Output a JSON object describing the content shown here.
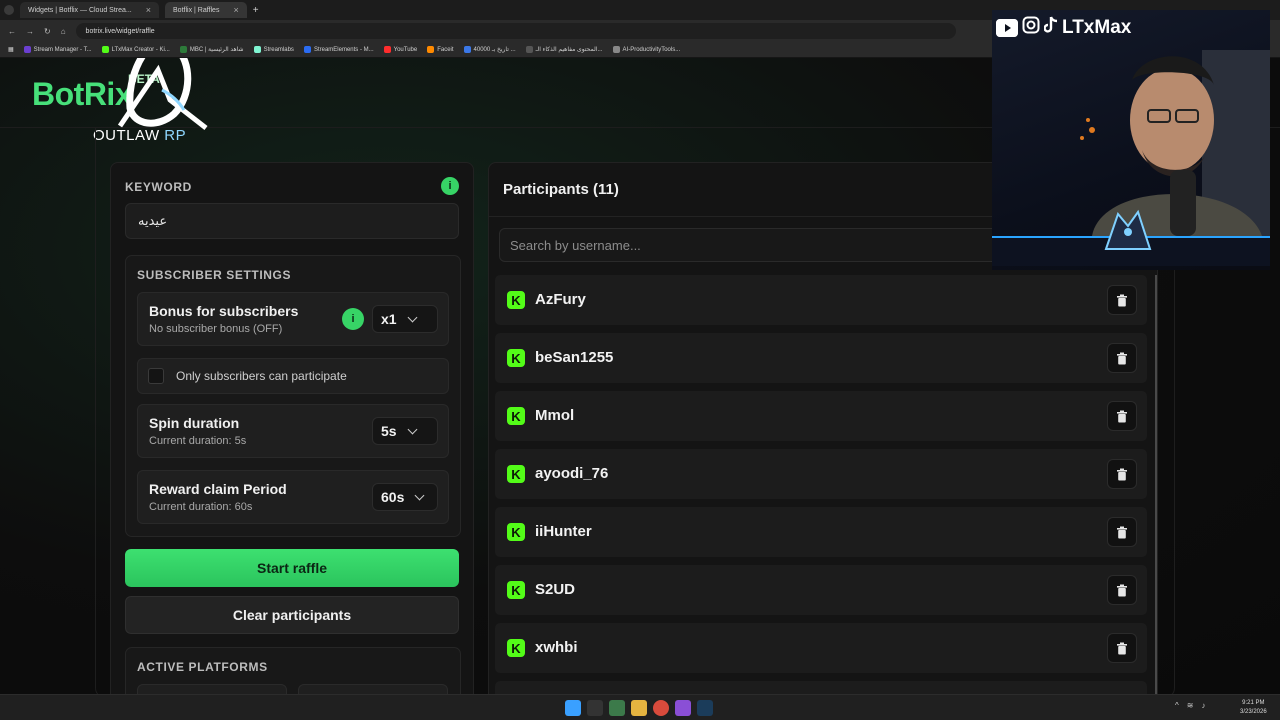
{
  "browser": {
    "tabs": [
      {
        "label": "Widgets | Botflix — Cloud Strea..."
      },
      {
        "label": "Botflix | Raffles"
      }
    ],
    "url": "botrix.live/widget/raffle",
    "bookmarks": [
      "Stream Manager - T...",
      "LTxMax Creator - Ki...",
      "MBC | شاهد الرئيسية",
      "Streamlabs",
      "StreamElements - M...",
      "YouTube",
      "Faceit",
      "تاريخ بـ 40000 ...",
      "المحتوى مفاهيم الذكاء الـ...",
      "AI-ProductivityTools..."
    ]
  },
  "brand": {
    "name": "BotRix",
    "badge": "BETA",
    "overlay_text_a": "OUTLAW",
    "overlay_text_b": "RP"
  },
  "raffle": {
    "keyword_label": "KEYWORD",
    "keyword_value": "عيديه",
    "info_glyph": "i",
    "subscriber_settings_label": "SUBSCRIBER SETTINGS",
    "bonus_label": "Bonus for subscribers",
    "bonus_sub": "No subscriber bonus (OFF)",
    "bonus_value": "x1",
    "only_subs_label": "Only subscribers can participate",
    "only_subs_checked": false,
    "spin_label": "Spin duration",
    "spin_sub": "Current duration: 5s",
    "spin_value": "5s",
    "claim_label": "Reward claim Period",
    "claim_sub": "Current duration: 60s",
    "claim_value": "60s",
    "start_button": "Start raffle",
    "clear_button": "Clear participants",
    "platforms_label": "ACTIVE PLATFORMS"
  },
  "participants": {
    "title": "Participants (11)",
    "search_placeholder": "Search by username...",
    "platform_glyph": "K",
    "items": [
      {
        "name": "AzFury"
      },
      {
        "name": "beSan1255"
      },
      {
        "name": "Mmol"
      },
      {
        "name": "ayoodi_76"
      },
      {
        "name": "iiHunter"
      },
      {
        "name": "S2UD"
      },
      {
        "name": "xwhbi"
      }
    ]
  },
  "webcam": {
    "handle": "LTxMax"
  },
  "taskbar": {
    "time": "9:21 PM",
    "date": "3/23/2026"
  },
  "colors": {
    "accent": "#3de070",
    "kick_green": "#53fc18",
    "panel": "#141414",
    "webcam_border": "#2aa4ff"
  }
}
